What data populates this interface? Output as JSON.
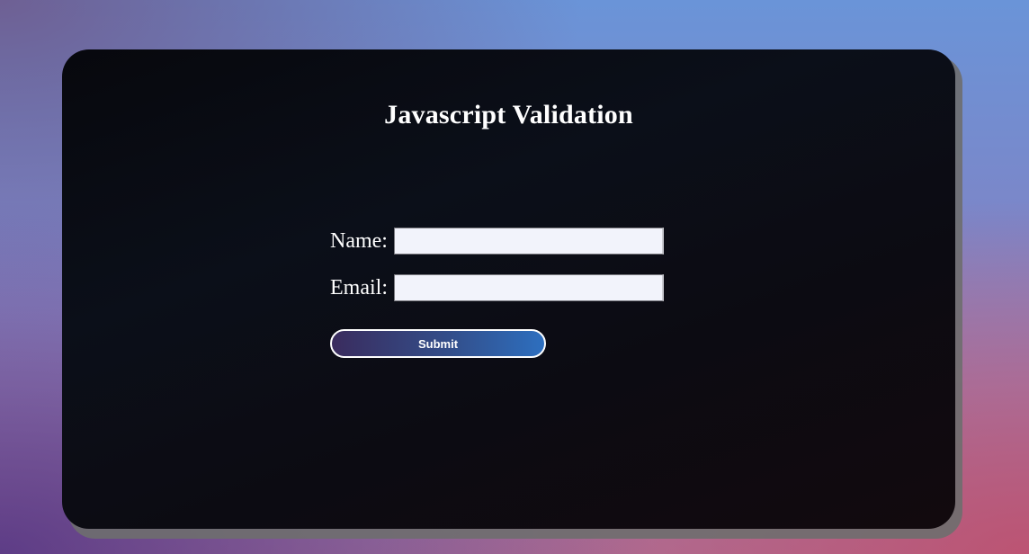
{
  "page": {
    "title": "Javascript Validation"
  },
  "form": {
    "name_label": "Name:",
    "name_value": "",
    "email_label": "Email:",
    "email_value": "",
    "submit_label": "Submit"
  },
  "colors": {
    "card_background": "#0b0f19",
    "input_background": "#f2f3fb",
    "button_gradient_start": "#3a2c5e",
    "button_gradient_end": "#2d6fbf",
    "text": "#ffffff"
  }
}
